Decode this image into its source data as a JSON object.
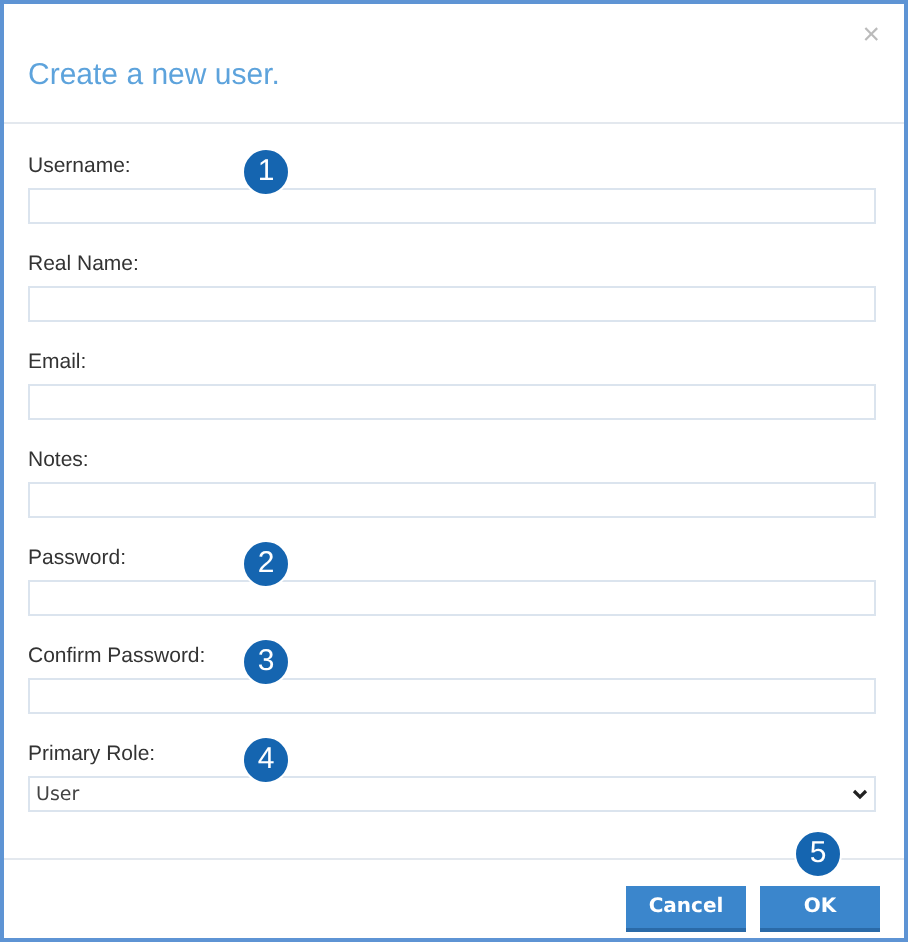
{
  "dialog": {
    "title": "Create a new user.",
    "close": "×"
  },
  "fields": [
    {
      "kind": "text",
      "label": "Username:",
      "callout": "1"
    },
    {
      "kind": "text",
      "label": "Real Name:"
    },
    {
      "kind": "text",
      "label": "Email:"
    },
    {
      "kind": "text",
      "label": "Notes:"
    },
    {
      "kind": "text",
      "label": "Password:",
      "callout": "2"
    },
    {
      "kind": "text",
      "label": "Confirm Password:",
      "callout": "3"
    },
    {
      "kind": "select",
      "label": "Primary Role:",
      "value": "User",
      "callout": "4"
    }
  ],
  "buttons": [
    {
      "label": "Cancel"
    },
    {
      "label": "OK",
      "callout": "5"
    }
  ]
}
